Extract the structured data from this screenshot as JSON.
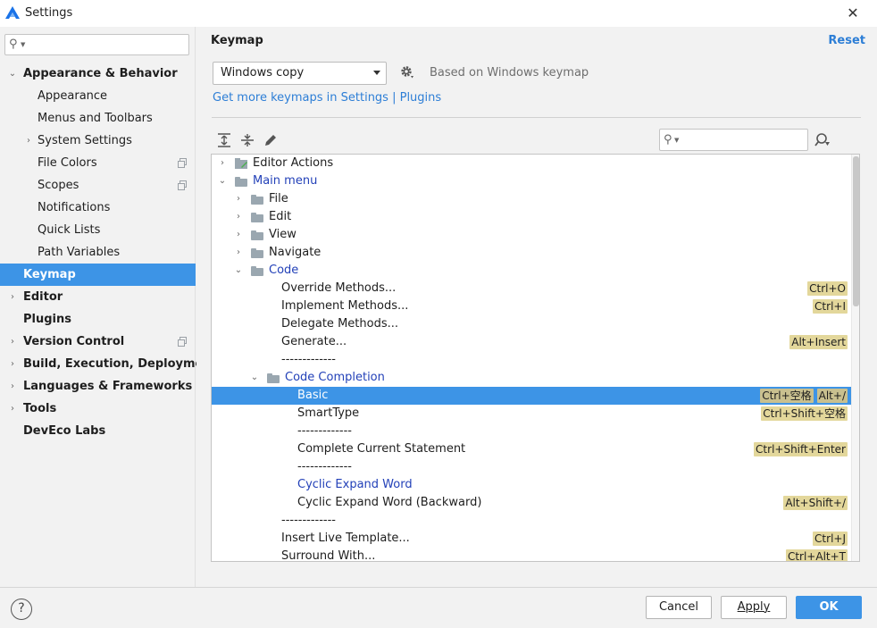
{
  "window": {
    "title": "Settings"
  },
  "sidebar": {
    "search_placeholder": "",
    "items": [
      {
        "label": "Appearance & Behavior",
        "arrow": "⌄",
        "bold": true,
        "indent": 0
      },
      {
        "label": "Appearance",
        "indent": 1
      },
      {
        "label": "Menus and Toolbars",
        "indent": 1
      },
      {
        "label": "System Settings",
        "arrow": "›",
        "indent": 1
      },
      {
        "label": "File Colors",
        "indent": 1,
        "copy_icon": true
      },
      {
        "label": "Scopes",
        "indent": 1,
        "copy_icon": true
      },
      {
        "label": "Notifications",
        "indent": 1
      },
      {
        "label": "Quick Lists",
        "indent": 1
      },
      {
        "label": "Path Variables",
        "indent": 1
      },
      {
        "label": "Keymap",
        "bold": true,
        "selected": true,
        "indent": 0
      },
      {
        "label": "Editor",
        "arrow": "›",
        "bold": true,
        "indent": 0
      },
      {
        "label": "Plugins",
        "bold": true,
        "indent": 0
      },
      {
        "label": "Version Control",
        "arrow": "›",
        "bold": true,
        "indent": 0,
        "copy_icon": true
      },
      {
        "label": "Build, Execution, Deployment",
        "arrow": "›",
        "bold": true,
        "indent": 0
      },
      {
        "label": "Languages & Frameworks",
        "arrow": "›",
        "bold": true,
        "indent": 0
      },
      {
        "label": "Tools",
        "arrow": "›",
        "bold": true,
        "indent": 0
      },
      {
        "label": "DevEco Labs",
        "bold": true,
        "indent": 0
      }
    ]
  },
  "keymap": {
    "title": "Keymap",
    "reset_label": "Reset",
    "selected_keymap": "Windows copy",
    "based_on": "Based on Windows keymap",
    "more_keymaps_link": "Get more keymaps in Settings | Plugins",
    "search_placeholder": ""
  },
  "tree": [
    {
      "label": "Editor Actions",
      "level": 0,
      "arrow": "›",
      "icon": "editor-actions"
    },
    {
      "label": "Main menu",
      "level": 0,
      "arrow": "⌄",
      "icon": "folder",
      "blue": true
    },
    {
      "label": "File",
      "level": 1,
      "arrow": "›",
      "icon": "folder"
    },
    {
      "label": "Edit",
      "level": 1,
      "arrow": "›",
      "icon": "folder"
    },
    {
      "label": "View",
      "level": 1,
      "arrow": "›",
      "icon": "folder"
    },
    {
      "label": "Navigate",
      "level": 1,
      "arrow": "›",
      "icon": "folder"
    },
    {
      "label": "Code",
      "level": 1,
      "arrow": "⌄",
      "icon": "folder",
      "blue": true
    },
    {
      "label": "Override Methods...",
      "level": 2,
      "shortcuts": [
        "Ctrl+O"
      ]
    },
    {
      "label": "Implement Methods...",
      "level": 2,
      "shortcuts": [
        "Ctrl+I"
      ]
    },
    {
      "label": "Delegate Methods...",
      "level": 2
    },
    {
      "label": "Generate...",
      "level": 2,
      "shortcuts": [
        "Alt+Insert"
      ]
    },
    {
      "label": "-------------",
      "level": 2
    },
    {
      "label": "Code Completion",
      "level": 2,
      "arrow": "⌄",
      "icon": "folder",
      "blue": true
    },
    {
      "label": "Basic",
      "level": 3,
      "selected": true,
      "shortcuts": [
        "Ctrl+空格",
        "Alt+/"
      ]
    },
    {
      "label": "SmartType",
      "level": 3,
      "shortcuts": [
        "Ctrl+Shift+空格"
      ]
    },
    {
      "label": "-------------",
      "level": 3
    },
    {
      "label": "Complete Current Statement",
      "level": 3,
      "shortcuts": [
        "Ctrl+Shift+Enter"
      ]
    },
    {
      "label": "-------------",
      "level": 3
    },
    {
      "label": "Cyclic Expand Word",
      "level": 3,
      "blue": true
    },
    {
      "label": "Cyclic Expand Word (Backward)",
      "level": 3,
      "shortcuts": [
        "Alt+Shift+/"
      ]
    },
    {
      "label": "-------------",
      "level": 2
    },
    {
      "label": "Insert Live Template...",
      "level": 2,
      "shortcuts": [
        "Ctrl+J"
      ]
    },
    {
      "label": "Surround With...",
      "level": 2,
      "shortcuts": [
        "Ctrl+Alt+T"
      ]
    }
  ],
  "footer": {
    "help_label": "?",
    "cancel_label": "Cancel",
    "apply_label": "Apply",
    "ok_label": "OK"
  },
  "colors": {
    "accent": "#3d94e6",
    "link": "#2d7ed6",
    "highlight_text": "#2341b8",
    "shortcut_badge": "#e3d79b"
  },
  "icons": {
    "app": "deveco-logo-icon",
    "close": "close-icon",
    "expand_all": "expand-all-icon",
    "collapse_all": "collapse-all-icon",
    "edit": "pencil-icon",
    "settings": "gear-icon",
    "find_by_shortcut": "find-shortcut-icon"
  }
}
